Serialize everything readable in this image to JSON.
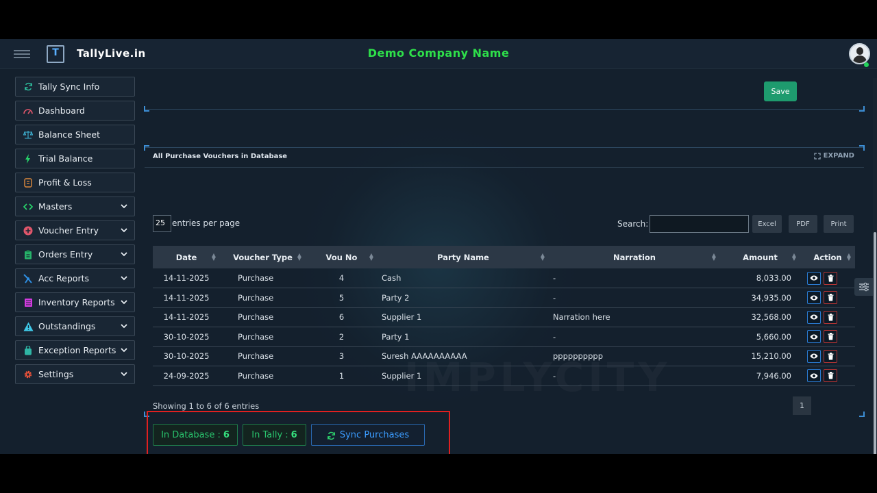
{
  "header": {
    "brand": "TallyLive.in",
    "logo_letter": "T",
    "company_name": "Demo Company Name",
    "accent_green": "#2ee04a"
  },
  "sidebar": {
    "items": [
      {
        "label": "Tally Sync Info",
        "icon": "sync-icon",
        "has_chevron": false
      },
      {
        "label": "Dashboard",
        "icon": "gauge-icon",
        "has_chevron": false
      },
      {
        "label": "Balance Sheet",
        "icon": "scale-icon",
        "has_chevron": false
      },
      {
        "label": "Trial Balance",
        "icon": "bolt-icon",
        "has_chevron": false
      },
      {
        "label": "Profit & Loss",
        "icon": "receipt-icon",
        "has_chevron": false
      },
      {
        "label": "Masters",
        "icon": "code-icon",
        "has_chevron": true
      },
      {
        "label": "Voucher Entry",
        "icon": "plus-circle-icon",
        "has_chevron": true
      },
      {
        "label": "Orders Entry",
        "icon": "clipboard-icon",
        "has_chevron": true
      },
      {
        "label": "Acc Reports",
        "icon": "chart-icon",
        "has_chevron": true
      },
      {
        "label": "Inventory Reports",
        "icon": "inventory-icon",
        "has_chevron": true
      },
      {
        "label": "Outstandings",
        "icon": "warning-icon",
        "has_chevron": true
      },
      {
        "label": "Exception Reports",
        "icon": "bag-icon",
        "has_chevron": true
      },
      {
        "label": "Settings",
        "icon": "gear-icon",
        "has_chevron": true
      }
    ]
  },
  "top_panel": {
    "save_label": "Save"
  },
  "vouchers_panel": {
    "title": "All Purchase Vouchers in Database",
    "expand_label": "EXPAND",
    "page_length": "25",
    "length_label": "entries per page",
    "search_label": "Search:",
    "search_value": "",
    "export_buttons": [
      "Excel",
      "PDF",
      "Print"
    ],
    "columns": [
      "Date",
      "Voucher Type",
      "Vou No",
      "Party Name",
      "Narration",
      "Amount",
      "Action"
    ],
    "rows": [
      {
        "date": "14-11-2025",
        "type": "Purchase",
        "vou_no": "4",
        "party": "Cash",
        "narration": "-",
        "amount": "8,033.00"
      },
      {
        "date": "14-11-2025",
        "type": "Purchase",
        "vou_no": "5",
        "party": "Party 2",
        "narration": "-",
        "amount": "34,935.00"
      },
      {
        "date": "14-11-2025",
        "type": "Purchase",
        "vou_no": "6",
        "party": "Supplier 1",
        "narration": "Narration here",
        "amount": "32,568.00"
      },
      {
        "date": "30-10-2025",
        "type": "Purchase",
        "vou_no": "2",
        "party": "Party 1",
        "narration": "-",
        "amount": "5,660.00"
      },
      {
        "date": "30-10-2025",
        "type": "Purchase",
        "vou_no": "3",
        "party": "Suresh AAAAAAAAAA",
        "narration": "pppppppppp",
        "amount": "15,210.00"
      },
      {
        "date": "24-09-2025",
        "type": "Purchase",
        "vou_no": "1",
        "party": "Supplier 1",
        "narration": "-",
        "amount": "7,946.00"
      }
    ],
    "info": "Showing 1 to 6 of 6 entries",
    "current_page": "1"
  },
  "sync_bar": {
    "in_database_label": "In Database :",
    "in_database_count": "6",
    "in_tally_label": "In Tally :",
    "in_tally_count": "6",
    "sync_label": "Sync Purchases"
  }
}
